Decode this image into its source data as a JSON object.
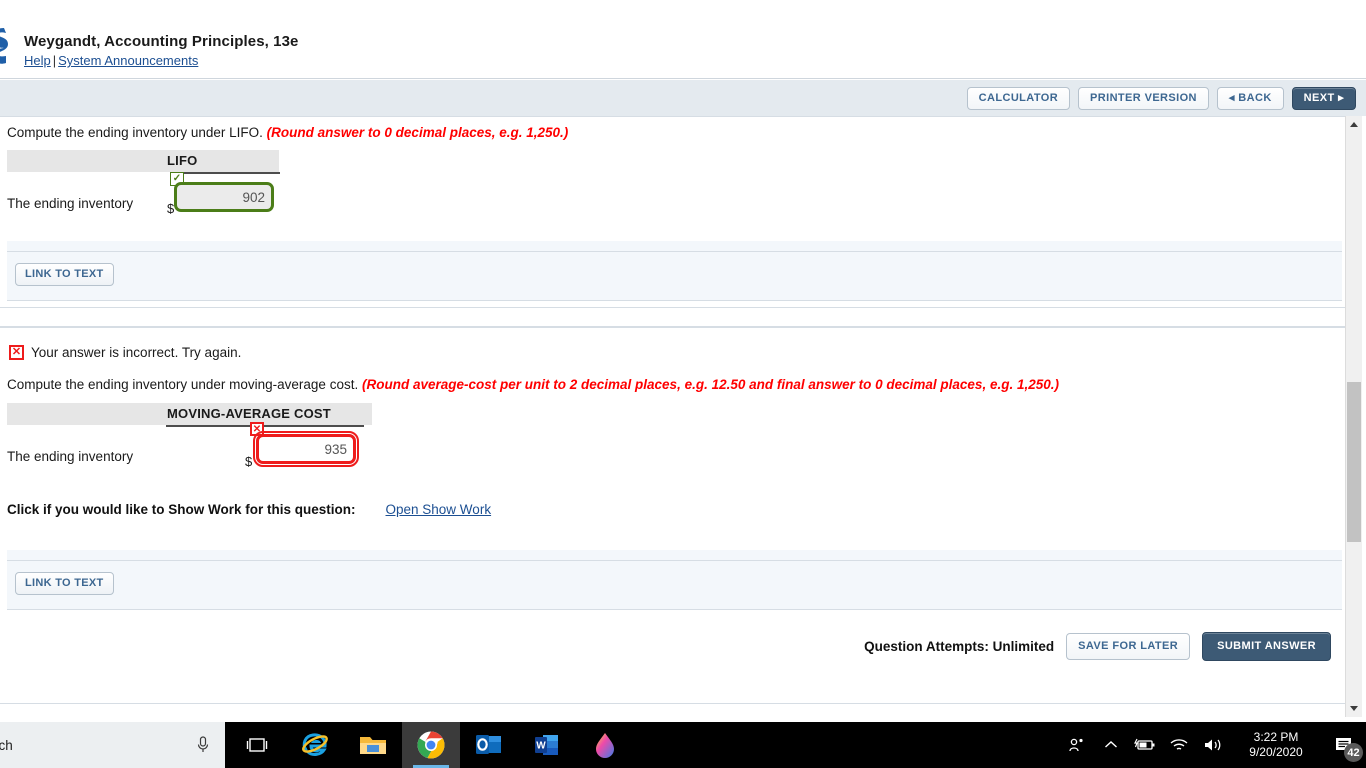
{
  "header": {
    "title": "Weygandt, Accounting Principles, 13e",
    "help_link": "Help",
    "separator": "|",
    "announcements_link": "System Announcements",
    "logo_icon": "wiley-logo-icon"
  },
  "toolbar": {
    "calculator_label": "CALCULATOR",
    "printer_label": "PRINTER VERSION",
    "back_label": "◂ BACK",
    "next_label": "NEXT ▸"
  },
  "question_lifo": {
    "prompt": "Compute the ending inventory under LIFO.",
    "note": "(Round answer to 0 decimal places, e.g. 1,250.)",
    "column_header": "LIFO",
    "row_label": "The ending inventory",
    "currency_symbol": "$",
    "answer_value": "902",
    "status": "correct",
    "status_badge_glyph": "✓",
    "link_to_text_label": "LINK TO TEXT"
  },
  "question_moving_average": {
    "feedback_icon_glyph": "✕",
    "feedback_text": "Your answer is incorrect.  Try again.",
    "prompt": "Compute the ending inventory under moving-average cost.",
    "note": "(Round average-cost per unit to 2 decimal places, e.g. 12.50 and final answer to 0 decimal places, e.g. 1,250.)",
    "column_header": "MOVING-AVERAGE COST",
    "row_label": "The ending inventory",
    "currency_symbol": "$",
    "answer_value": "935",
    "status": "incorrect",
    "status_badge_glyph": "✕",
    "show_work_label": "Click if you would like to Show Work for this question:",
    "show_work_link": "Open Show Work",
    "link_to_text_label": "LINK TO TEXT"
  },
  "footer": {
    "attempts_label": "Question Attempts: Unlimited",
    "save_label": "SAVE FOR LATER",
    "submit_label": "SUBMIT ANSWER"
  },
  "taskbar": {
    "search_text": "rch",
    "mic_icon": "microphone-icon",
    "taskview_icon": "task-view-icon",
    "edge_icon": "internet-explorer-icon",
    "explorer_icon": "file-explorer-icon",
    "chrome_icon": "google-chrome-icon",
    "outlook_icon": "outlook-icon",
    "word_icon": "word-icon",
    "paint3d_icon": "paint-3d-icon",
    "tray": {
      "people_icon": "people-icon",
      "chevron_icon": "chevron-up-icon",
      "battery_icon": "battery-charging-icon",
      "wifi_icon": "wifi-icon",
      "volume_icon": "volume-icon",
      "time": "3:22 PM",
      "date": "9/20/2020",
      "notification_icon": "notification-icon",
      "notification_count": "42"
    }
  },
  "colors": {
    "accent_blue": "#1c4f92",
    "dark_button": "#3d5a75",
    "correct_green": "#4b7d18",
    "error_red": "#ee1c1c",
    "note_red": "#ff0000"
  }
}
